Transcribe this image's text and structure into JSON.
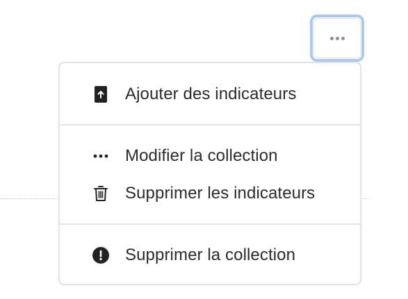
{
  "toolbar": {
    "more_button_icon": "more-horizontal-icon"
  },
  "menu": {
    "groups": [
      {
        "items": [
          {
            "label": "Ajouter des indicateurs",
            "icon": "upload-file-icon"
          }
        ]
      },
      {
        "items": [
          {
            "label": "Modifier la collection",
            "icon": "more-horizontal-icon"
          },
          {
            "label": "Supprimer les indicateurs",
            "icon": "trash-icon"
          }
        ]
      },
      {
        "items": [
          {
            "label": "Supprimer la collection",
            "icon": "alert-circle-icon"
          }
        ]
      }
    ]
  },
  "colors": {
    "focus_ring": "#a9c8f3",
    "text": "#2b2b2b",
    "icon": "#222222",
    "border": "#e2e2e2"
  }
}
